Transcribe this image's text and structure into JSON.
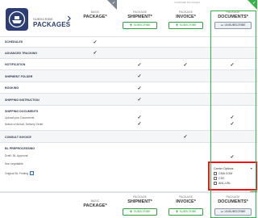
{
  "caption": "COMPARE PACKAGES",
  "logo": {
    "sub": "SUBSCRIBE",
    "main": "PACKAGES",
    "icon": "ship-icon"
  },
  "packages": [
    {
      "tag": "BASIC",
      "name": "PACKAGE*",
      "button": ""
    },
    {
      "tag": "PACKAGE",
      "name": "SHIPMENT*",
      "button": "SUBSCRIBE",
      "button_icon": "+"
    },
    {
      "tag": "PACKAGE",
      "name": "INVOICE*",
      "button": "SUBSCRIBE",
      "button_icon": "+"
    },
    {
      "tag": "PACKAGE",
      "name": "DOCUMENTS*",
      "button": "UNSUBSCRIBE",
      "button_icon": "−"
    }
  ],
  "rows": [
    {
      "label": "SCHEDULES",
      "checks": [
        true,
        false,
        false,
        false
      ]
    },
    {
      "label": "ADVANCED TRACKING",
      "checks": [
        true,
        false,
        false,
        false
      ]
    },
    {
      "label": "NOTIFICATION",
      "checks": [
        false,
        true,
        true,
        true
      ]
    },
    {
      "label": "SHIPMENT FOLDER",
      "checks": [
        false,
        true,
        false,
        false
      ]
    },
    {
      "label": "BOOKING",
      "checks": [
        false,
        true,
        false,
        false
      ]
    },
    {
      "label": "SHIPPING INSTRUCTION",
      "checks": [
        false,
        true,
        false,
        false
      ]
    }
  ],
  "shipping_documents": {
    "label": "SHIPPING DOCUMENTS",
    "subitems": [
      {
        "label": "Upload your Documents",
        "checks": [
          false,
          true,
          false,
          true
        ]
      },
      {
        "label": "Notice of Arrival, Delivery Order",
        "checks": [
          false,
          true,
          false,
          true
        ]
      }
    ]
  },
  "consult_invoice": {
    "label": "CONSULT INVOICE",
    "checks": [
      false,
      false,
      true,
      false
    ]
  },
  "bl": {
    "label": "BL PREPROCESSING",
    "subitems": [
      {
        "label": "Draft / BL Approval",
        "checks": [
          false,
          false,
          false,
          true
        ]
      },
      {
        "label": "Non negotiable"
      },
      {
        "label": "Original BL Printing"
      }
    ]
  },
  "carrier_options": {
    "title": "Carrier Options",
    "options": [
      "CMA CGM",
      "CSC",
      "ANL-USL"
    ]
  },
  "check_mark": "✓"
}
